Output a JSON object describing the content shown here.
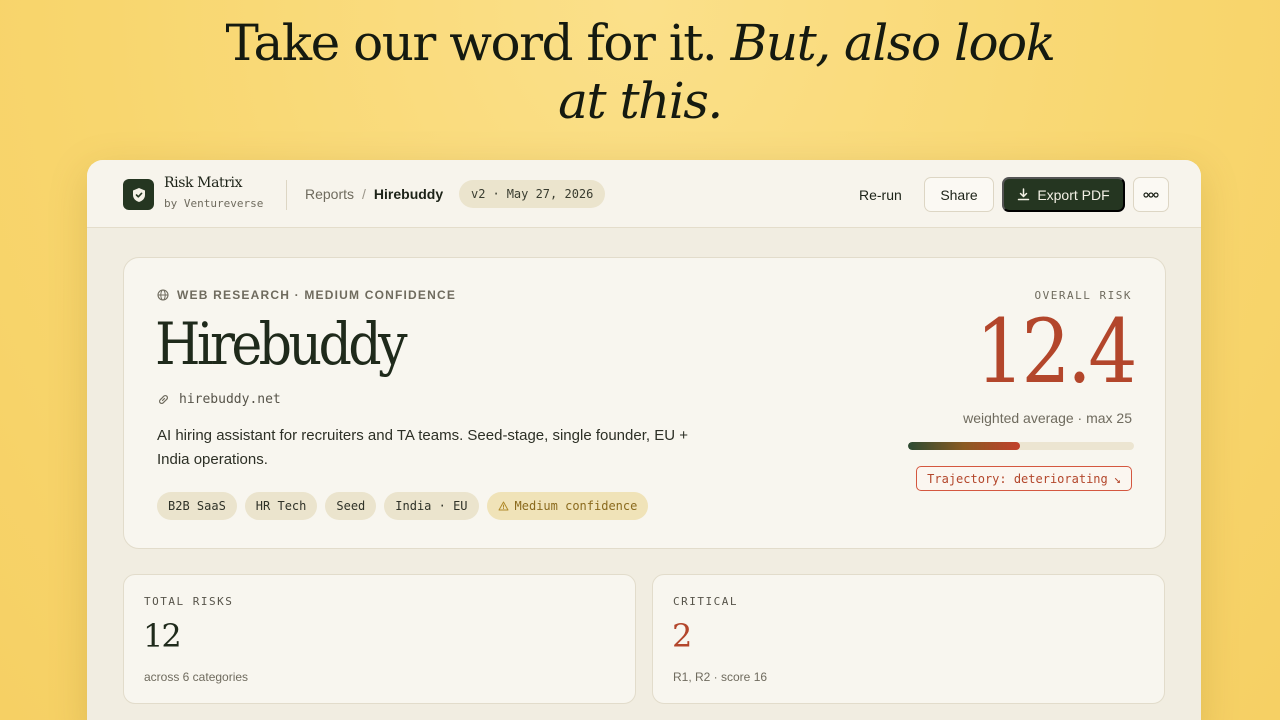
{
  "hero": {
    "line1_plain": "Take our word for it. ",
    "line1_italic": "But, also look",
    "line2_italic": "at this."
  },
  "topbar": {
    "brand_name": "Risk Matrix",
    "brand_by": "by Ventureverse",
    "breadcrumb_root": "Reports",
    "breadcrumb_sep": "/",
    "breadcrumb_current": "Hirebuddy",
    "version": "v2",
    "version_dot": "·",
    "version_date": "May 27, 2026",
    "rerun_label": "Re-run",
    "share_label": "Share",
    "export_label": "Export PDF"
  },
  "report": {
    "source": "WEB RESEARCH · MEDIUM CONFIDENCE",
    "company": "Hirebuddy",
    "domain": "hirebuddy.net",
    "description": "AI hiring assistant for recruiters and TA teams. Seed-stage, single founder, EU + India operations.",
    "tags": [
      "B2B SaaS",
      "HR Tech",
      "Seed",
      "India · EU"
    ],
    "warn_tag": "Medium confidence",
    "overall_label": "OVERALL RISK",
    "overall_score": "12.4",
    "overall_sub": "weighted average · max 25",
    "overall_fraction": 0.496,
    "trajectory": "Trajectory: deteriorating",
    "trajectory_arrow": "↘"
  },
  "stats": {
    "total": {
      "label": "TOTAL RISKS",
      "value": "12",
      "sub": "across 6 categories"
    },
    "critical": {
      "label": "CRITICAL",
      "value": "2",
      "sub": "R1, R2 · score 16"
    }
  },
  "colors": {
    "brand_dark": "#253621",
    "risk_red": "#b3462b",
    "background_yellow": "#f8d66e"
  },
  "icons": [
    "shield-icon",
    "globe-icon",
    "link-icon",
    "download-icon",
    "more-icon",
    "warning-icon"
  ]
}
